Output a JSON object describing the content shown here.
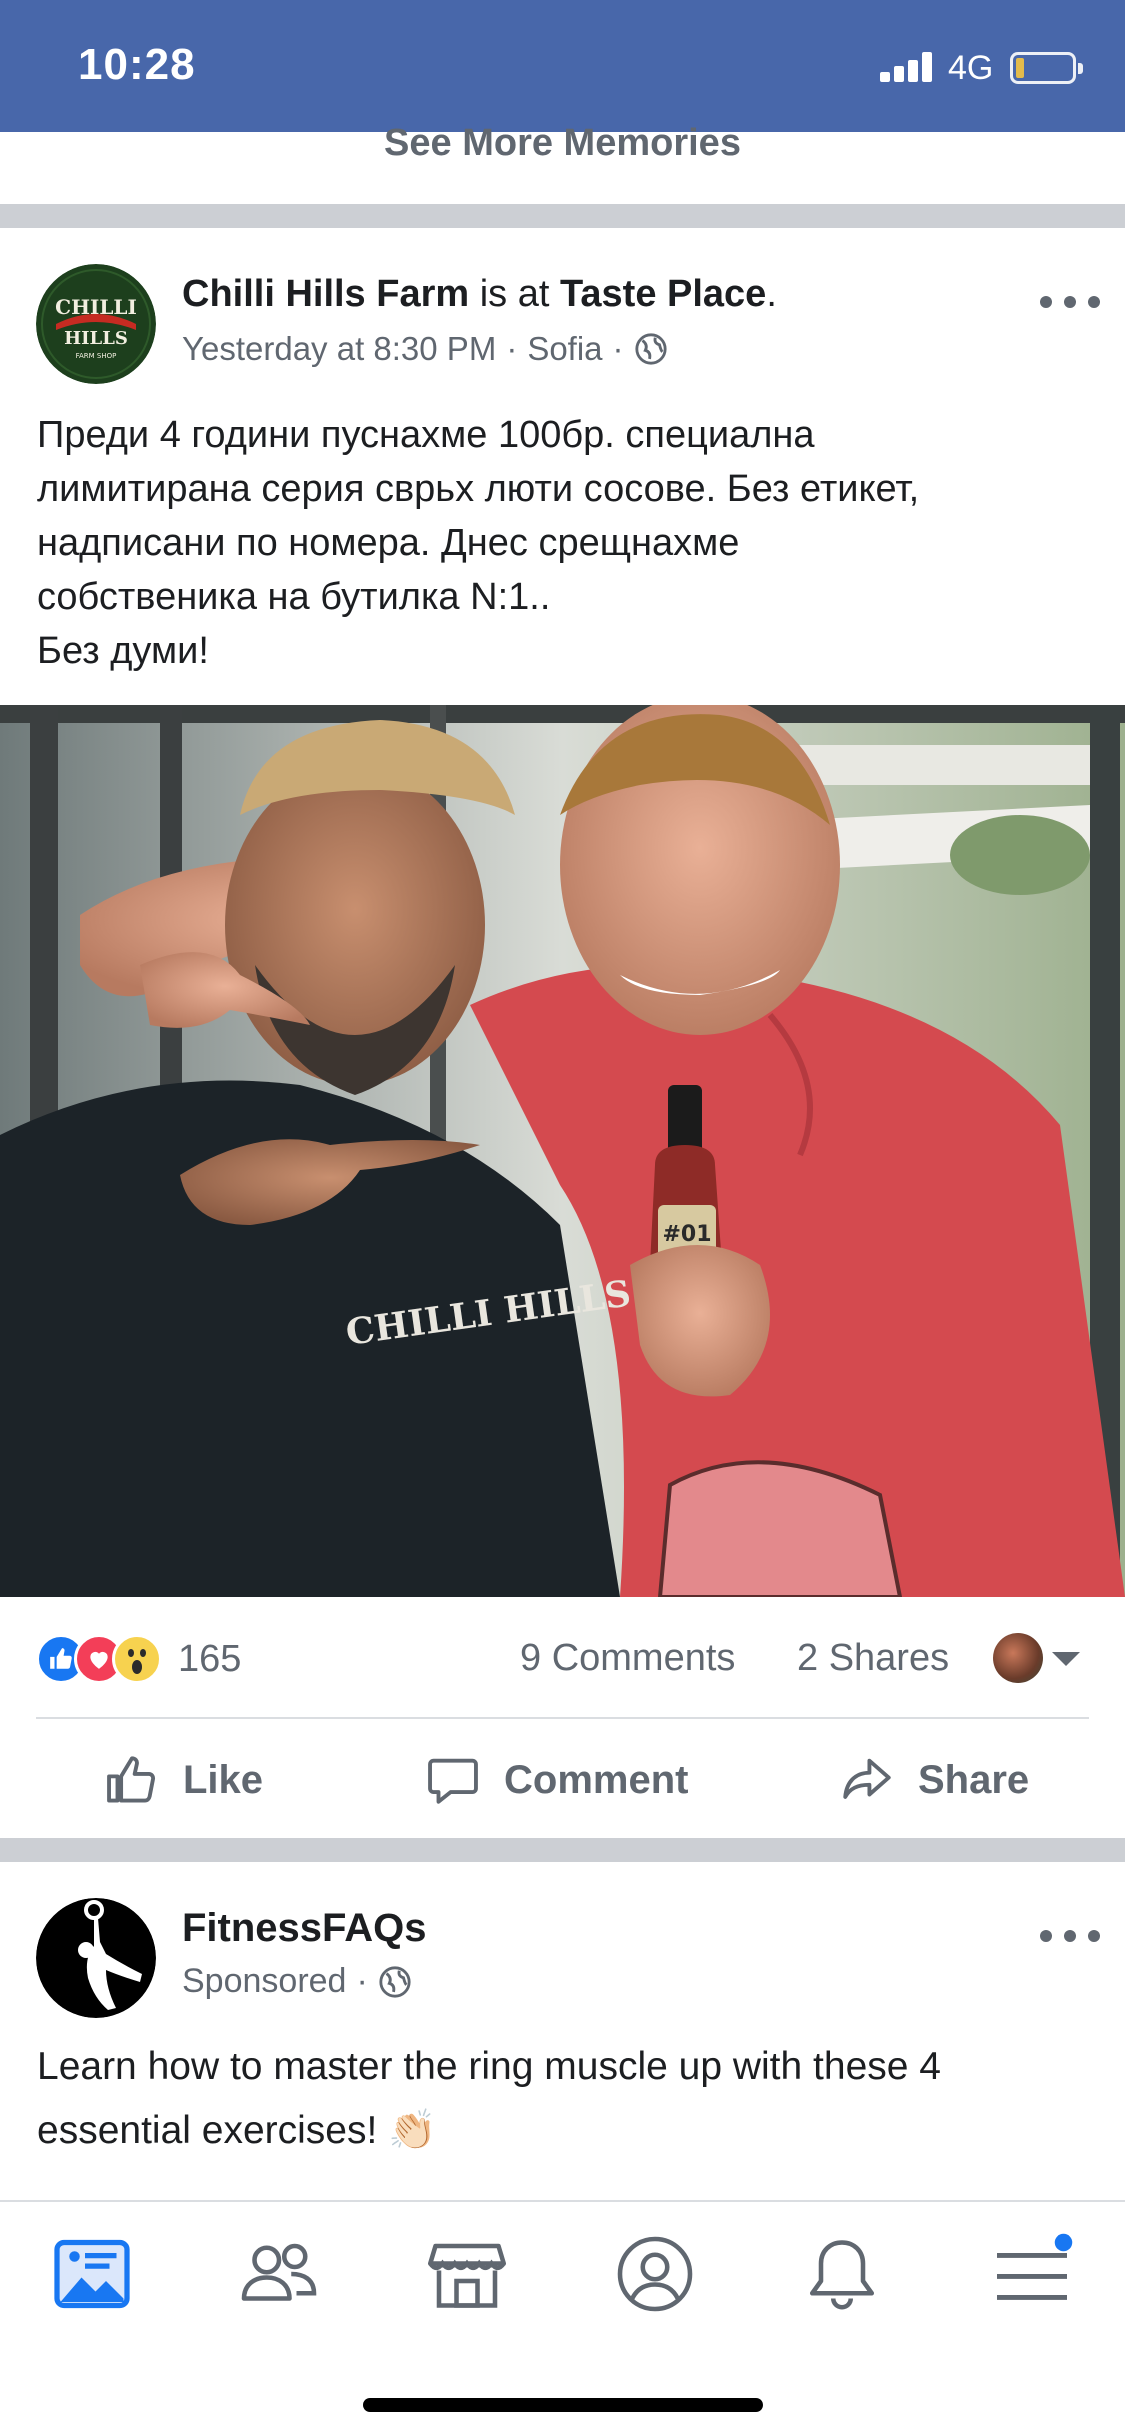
{
  "status_bar": {
    "time": "10:28",
    "network": "4G"
  },
  "feed": {
    "see_more_label": "See More Memories"
  },
  "post": {
    "author": "Chilli Hills Farm",
    "is_at": "is at",
    "place": "Taste Place",
    "period": ".",
    "time": "Yesterday at 8:30 PM",
    "separator": "·",
    "location": "Sofia",
    "avatar_logo_text": "CHILLI HILLS FARM SHOP",
    "text_lines": [
      "Преди 4 години пуснахме 100бр. специална",
      "лимитирана серия сврьх люти сосове. Без етикет,",
      "надписани по номера. Днес срещнахме",
      "собственика на бутилка N:1..",
      "Без думи!"
    ],
    "photo_shirt_text": "CHILLI HILLS",
    "photo_bottle_label": "#01",
    "reaction_count": "165",
    "comments": "9 Comments",
    "shares": "2 Shares",
    "actions": {
      "like": "Like",
      "comment": "Comment",
      "share": "Share"
    }
  },
  "sponsored_post": {
    "author": "FitnessFAQs",
    "meta": "Sponsored",
    "separator": "·",
    "text": "Learn how to master the ring muscle up with these 4 essential exercises! 👏🏻"
  },
  "tabbar": {
    "icons": [
      "news-feed-icon",
      "friends-icon",
      "marketplace-icon",
      "profile-icon",
      "notifications-icon",
      "menu-icon"
    ],
    "colors": {
      "active": "#1877f2",
      "inactive": "#606770",
      "brand": "#4867aa"
    }
  }
}
